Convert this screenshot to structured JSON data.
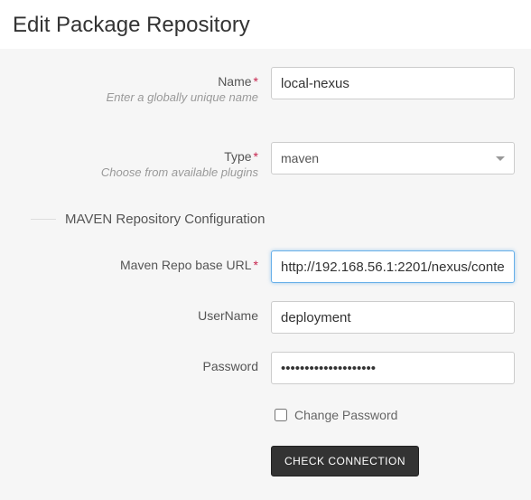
{
  "page": {
    "title": "Edit Package Repository"
  },
  "form": {
    "name": {
      "label": "Name",
      "required_mark": "*",
      "hint": "Enter a globally unique name",
      "value": "local-nexus"
    },
    "type": {
      "label": "Type",
      "required_mark": "*",
      "hint": "Choose from available plugins",
      "selected": "maven"
    }
  },
  "section": {
    "title": "MAVEN Repository Configuration"
  },
  "maven": {
    "base_url": {
      "label": "Maven Repo base URL",
      "required_mark": "*",
      "value": "http://192.168.56.1:2201/nexus/conte"
    },
    "username": {
      "label": "UserName",
      "value": "deployment"
    },
    "password": {
      "label": "Password",
      "value": "••••••••••••••••••••"
    },
    "change_password": {
      "label": "Change Password",
      "checked": false
    },
    "check_connection_label": "CHECK CONNECTION"
  }
}
